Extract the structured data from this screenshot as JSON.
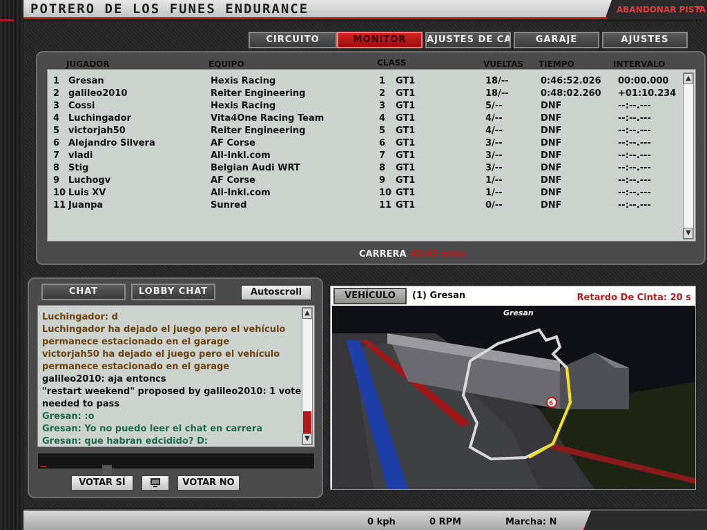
{
  "window": {
    "title": "POTRERO DE LOS FUNES ENDURANCE",
    "abandon_label": "ABANDONAR PISTA"
  },
  "tabs": [
    {
      "label": "CIRCUITO",
      "active": false
    },
    {
      "label": "MONITOR",
      "active": true
    },
    {
      "label": "AJUSTES DE CARRERA",
      "active": false
    },
    {
      "label": "GARAJE",
      "active": false
    },
    {
      "label": "AJUSTES",
      "active": false
    }
  ],
  "standings": {
    "headers": {
      "jugador": "JUGADOR",
      "equipo": "EQUIPO",
      "class": "CLASS",
      "vueltas": "VUELTAS",
      "tiempo": "TIEMPO",
      "intervalo": "INTERVALO"
    },
    "rows": [
      {
        "pos": "1",
        "player": "Gresan",
        "team": "Hexis Racing",
        "cpos": "1",
        "class": "GT1",
        "laps": "18/--",
        "time": "0:46:52.026",
        "interval": "00:00.000"
      },
      {
        "pos": "2",
        "player": "galileo2010",
        "team": "Reiter Engineering",
        "cpos": "2",
        "class": "GT1",
        "laps": "18/--",
        "time": "0:48:02.260",
        "interval": "+01:10.234"
      },
      {
        "pos": "3",
        "player": "Cossi",
        "team": "Hexis Racing",
        "cpos": "3",
        "class": "GT1",
        "laps": "5/--",
        "time": "DNF",
        "interval": "--:--.---"
      },
      {
        "pos": "4",
        "player": "Luchingador",
        "team": "Vita4One Racing Team",
        "cpos": "4",
        "class": "GT1",
        "laps": "4/--",
        "time": "DNF",
        "interval": "--:--.---"
      },
      {
        "pos": "5",
        "player": "victorjah50",
        "team": "Reiter Engineering",
        "cpos": "5",
        "class": "GT1",
        "laps": "4/--",
        "time": "DNF",
        "interval": "--:--.---"
      },
      {
        "pos": "6",
        "player": "Alejandro Silvera",
        "team": "AF Corse",
        "cpos": "6",
        "class": "GT1",
        "laps": "3/--",
        "time": "DNF",
        "interval": "--:--.---"
      },
      {
        "pos": "7",
        "player": "vladi",
        "team": "All-Inkl.com",
        "cpos": "7",
        "class": "GT1",
        "laps": "3/--",
        "time": "DNF",
        "interval": "--:--.---"
      },
      {
        "pos": "8",
        "player": "Stig",
        "team": "Belgian Audi WRT",
        "cpos": "8",
        "class": "GT1",
        "laps": "3/--",
        "time": "DNF",
        "interval": "--:--.---"
      },
      {
        "pos": "9",
        "player": "Luchogv",
        "team": "AF Corse",
        "cpos": "9",
        "class": "GT1",
        "laps": "1/--",
        "time": "DNF",
        "interval": "--:--.---"
      },
      {
        "pos": "10",
        "player": "Luis XV",
        "team": "All-Inkl.com",
        "cpos": "10",
        "class": "GT1",
        "laps": "1/--",
        "time": "DNF",
        "interval": "--:--.---"
      },
      {
        "pos": "11",
        "player": "Juanpa",
        "team": "Sunred",
        "cpos": "11",
        "class": "GT1",
        "laps": "0/--",
        "time": "DNF",
        "interval": "--:--.---"
      }
    ],
    "race_label": "CARRERA",
    "race_time": "45/45 mins"
  },
  "chat": {
    "tab_chat": "CHAT",
    "tab_lobby": "LOBBY CHAT",
    "autoscroll": "Autoscroll",
    "lines": [
      {
        "text": "Luchingador: d",
        "color": "brown"
      },
      {
        "text": "Luchingador ha dejado el juego pero el vehículo",
        "color": "brown"
      },
      {
        "text": "permanece estacionado en el garage",
        "color": "brown"
      },
      {
        "text": "victorjah50 ha dejado el juego pero el vehículo",
        "color": "brown"
      },
      {
        "text": "permanece estacionado en el garage",
        "color": "brown"
      },
      {
        "text": "galileo2010: aja entoncs",
        "color": "black"
      },
      {
        "text": "\"restart weekend\" proposed by galileo2010: 1 vote",
        "color": "black"
      },
      {
        "text": "needed to pass",
        "color": "black"
      },
      {
        "text": "Gresan: :o",
        "color": "green"
      },
      {
        "text": "Gresan: Yo no puedo leer el chat en carrera",
        "color": "green"
      },
      {
        "text": "Gresan: que habran edcidido? D:",
        "color": "green"
      }
    ],
    "vote_yes": "VOTAR SÍ",
    "vote_no": "VOTAR NO"
  },
  "vehicle": {
    "tab_label": "VEHÍCULO",
    "name": "(1) Gresan",
    "delay": "Retardo De Cinta: 20 s",
    "map_label": "Gresan",
    "marker_number": "6"
  },
  "status": {
    "speed": "0 kph",
    "rpm": "0 RPM",
    "gear": "Marcha: N"
  },
  "colors": {
    "accent_red": "#c01818",
    "brown": "#6b4210",
    "green": "#1f6a4e",
    "track_yellow": "#f2e21a"
  }
}
